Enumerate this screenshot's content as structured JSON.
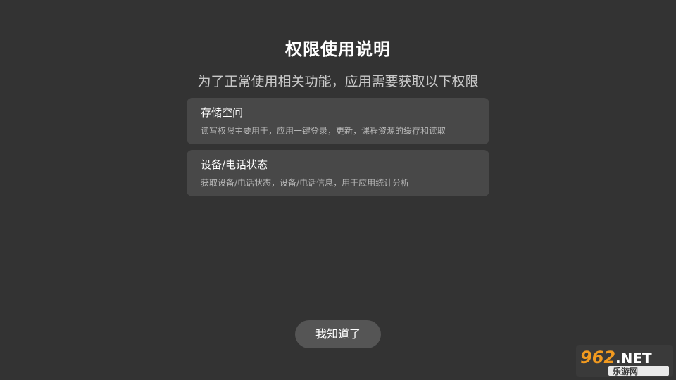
{
  "dialog": {
    "title": "权限使用说明",
    "subtitle": "为了正常使用相关功能，应用需要获取以下权限",
    "permissions": [
      {
        "name": "存储空间",
        "description": "读写权限主要用于，应用一键登录，更新，课程资源的缓存和读取"
      },
      {
        "name": "设备/电话状态",
        "description": "获取设备/电话状态，设备/电话信息，用于应用统计分析"
      }
    ],
    "confirm_label": "我知道了"
  },
  "watermark": {
    "brand_number": "962",
    "brand_suffix": ".NET",
    "brand_name": "乐游网"
  },
  "colors": {
    "background": "#333333",
    "card": "#484848",
    "button": "#555555",
    "title_text": "#ffffff",
    "subtitle_text": "#c9c9c9",
    "description_text": "#b8b8b8",
    "watermark_orange": "#f29a1f"
  }
}
